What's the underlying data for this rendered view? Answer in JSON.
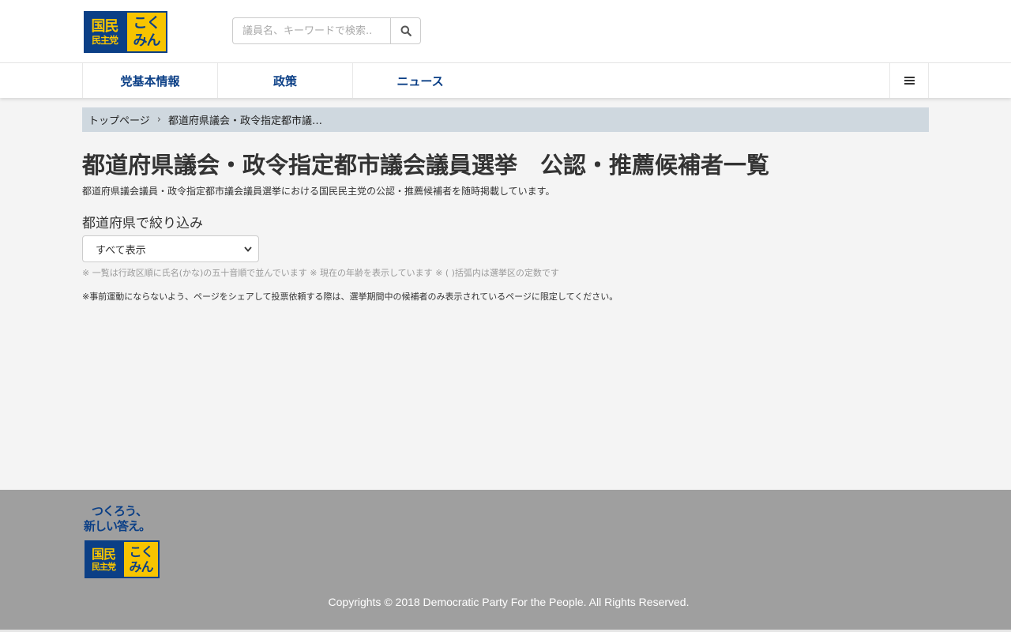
{
  "header": {
    "logo": {
      "kanji_top": "国民",
      "kanji_bottom": "民主党",
      "kana_top": "こく",
      "kana_bottom": "みん"
    },
    "search": {
      "placeholder": "議員名、キーワードで検索.."
    }
  },
  "nav": {
    "items": [
      {
        "label": "党基本情報"
      },
      {
        "label": "政策"
      },
      {
        "label": "ニュース"
      }
    ]
  },
  "breadcrumb": {
    "home": "トップページ",
    "separator": "›",
    "current": "都道府県議会・政令指定都市議…"
  },
  "main": {
    "title": "都道府県議会・政令指定都市議会議員選挙　公認・推薦候補者一覧",
    "lead": "都道府県議会議員・政令指定都市議会議員選挙における国民民主党の公認・推薦候補者を随時掲載しています。",
    "filter_label": "都道府県で絞り込み",
    "select_value": "すべて表示",
    "note1": "※ 一覧は行政区順に氏名(かな)の五十音順で並んでいます ※ 現在の年齢を表示しています ※ ( )括弧内は選挙区の定数です",
    "note2": "※事前運動にならないよう、ページをシェアして投票依頼する際は、選挙期間中の候補者のみ表示されているページに限定してください。"
  },
  "footer": {
    "tagline1": "つくろう、",
    "tagline2": "新しい答え。",
    "logo": {
      "kanji_top": "国民",
      "kanji_bottom": "民主党",
      "kana_top": "こく",
      "kana_bottom": "みん"
    },
    "copyright": "Copyrights © 2018 Democratic Party For the People. All Rights Reserved."
  },
  "colors": {
    "brand_blue": "#0b3f86",
    "brand_yellow": "#f7c400",
    "footer_bg": "#9f9f9f",
    "breadcrumb_bg": "#cfd8df"
  }
}
